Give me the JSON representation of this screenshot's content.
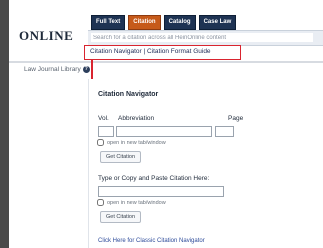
{
  "header": {
    "logo_text": "ONLINE",
    "tabs": [
      {
        "label": "Full Text"
      },
      {
        "label": "Citation"
      },
      {
        "label": "Catalog"
      },
      {
        "label": "Case Law"
      }
    ],
    "search_placeholder": "Search for a citation across all HeinOnline content",
    "links_text": "Citation Navigator | Citation Format Guide",
    "highlight_color": "#d9242f"
  },
  "sidebar": {
    "law_journal_label": "Law Journal Library"
  },
  "navigator": {
    "heading": "Citation Navigator",
    "vol_label": "Vol.",
    "abbr_label": "Abbreviation",
    "page_label": "Page",
    "open_new_tab_label": "open in new tab/window",
    "get_citation_label": "Get Citation",
    "paste_label": "Type or Copy and Paste Citation Here:",
    "open_new_tab_label_2": "open in new tab/window",
    "get_citation_label_2": "Get Citation",
    "classic_link": "Click Here for Classic Citation Navigator"
  },
  "colors": {
    "tab_bg": "#1e3353",
    "tab_active_bg": "#c65a1a"
  }
}
